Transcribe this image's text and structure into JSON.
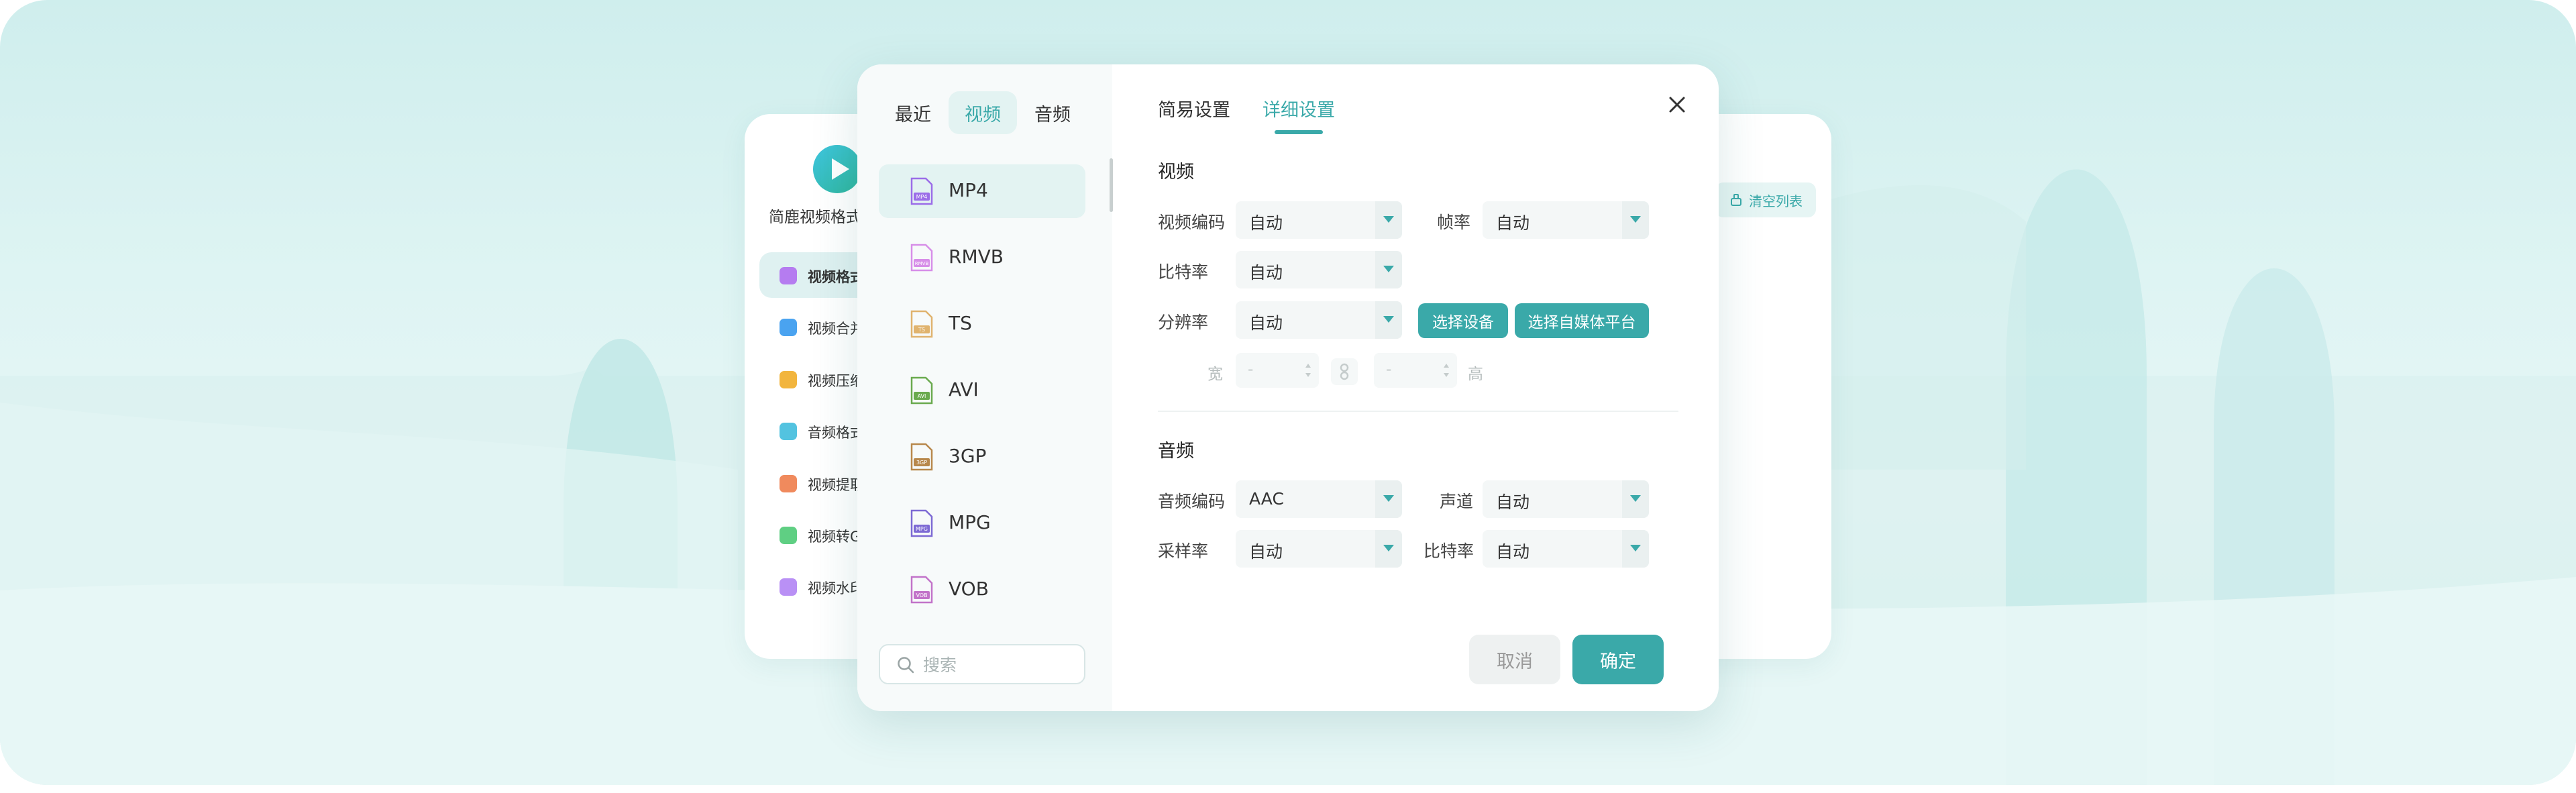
{
  "colors": {
    "accent": "#3aa9a9",
    "accent_light": "#e3f3f2"
  },
  "app": {
    "title": "简鹿视频格式",
    "clear_label": "清空列表",
    "sidebar": [
      {
        "label": "视频格式",
        "icon": "video-convert-icon",
        "color": "#b57cf0"
      },
      {
        "label": "视频合并",
        "icon": "video-merge-icon",
        "color": "#4aa3f0"
      },
      {
        "label": "视频压缩",
        "icon": "video-compress-icon",
        "color": "#f2b53d"
      },
      {
        "label": "音频格式",
        "icon": "audio-convert-icon",
        "color": "#53c3e0"
      },
      {
        "label": "视频提取",
        "icon": "video-extract-icon",
        "color": "#f08a5d"
      },
      {
        "label": "视频转GIF",
        "icon": "video-gif-icon",
        "color": "#5fcf83"
      },
      {
        "label": "视频水印",
        "icon": "video-watermark-icon",
        "color": "#b990f5"
      }
    ]
  },
  "dialog": {
    "tabs": [
      "最近",
      "视频",
      "音频"
    ],
    "formats": [
      {
        "label": "MP4",
        "tag": "MP4",
        "color": "#9b6de8"
      },
      {
        "label": "RMVB",
        "tag": "RMVB",
        "color": "#d78ee8"
      },
      {
        "label": "TS",
        "tag": "TS",
        "color": "#e0b36e"
      },
      {
        "label": "AVI",
        "tag": "AVI",
        "color": "#6aaa4e"
      },
      {
        "label": "3GP",
        "tag": "3GP",
        "color": "#b8884c"
      },
      {
        "label": "MPG",
        "tag": "MPG",
        "color": "#7d6ad4"
      },
      {
        "label": "VOB",
        "tag": "VOB",
        "color": "#c273c9"
      }
    ],
    "search_placeholder": "搜索",
    "right_tabs": [
      "简易设置",
      "详细设置"
    ],
    "video_section": "视频",
    "video_codec_label": "视频编码",
    "video_codec": "自动",
    "frame_rate_label": "帧率",
    "frame_rate": "自动",
    "bitrate_label": "比特率",
    "bitrate": "自动",
    "resolution_label": "分辨率",
    "resolution": "自动",
    "select_device": "选择设备",
    "select_platform": "选择自媒体平台",
    "width_label": "宽",
    "height_label": "高",
    "width_value": "-",
    "height_value": "-",
    "audio_section": "音频",
    "audio_codec_label": "音频编码",
    "audio_codec": "AAC",
    "channel_label": "声道",
    "channel": "自动",
    "sample_rate_label": "采样率",
    "sample_rate": "自动",
    "audio_bitrate_label": "比特率",
    "audio_bitrate": "自动",
    "cancel": "取消",
    "confirm": "确定"
  }
}
